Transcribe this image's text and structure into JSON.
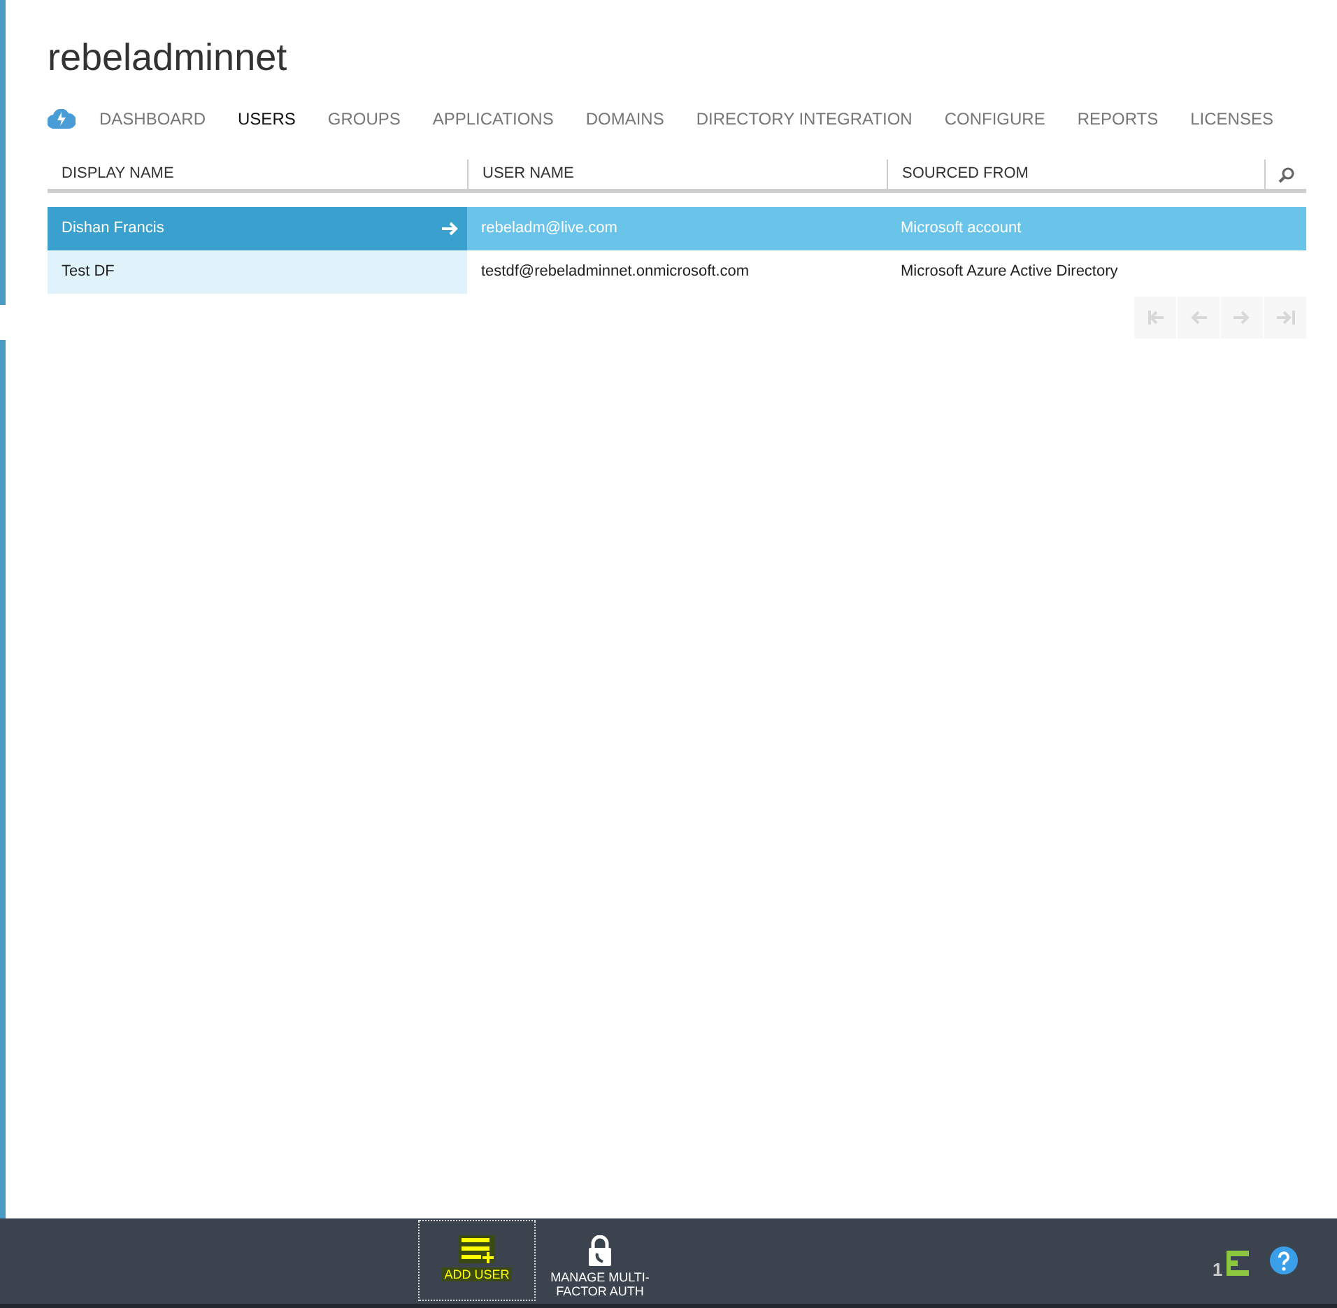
{
  "title": "rebeladminnet",
  "tabs": [
    {
      "label": "DASHBOARD",
      "selected": false
    },
    {
      "label": "USERS",
      "selected": true
    },
    {
      "label": "GROUPS",
      "selected": false
    },
    {
      "label": "APPLICATIONS",
      "selected": false
    },
    {
      "label": "DOMAINS",
      "selected": false
    },
    {
      "label": "DIRECTORY INTEGRATION",
      "selected": false
    },
    {
      "label": "CONFIGURE",
      "selected": false
    },
    {
      "label": "REPORTS",
      "selected": false
    },
    {
      "label": "LICENSES",
      "selected": false
    }
  ],
  "table": {
    "columns": [
      "DISPLAY NAME",
      "USER NAME",
      "SOURCED FROM"
    ],
    "rows": [
      {
        "cells": [
          "Dishan Francis",
          "rebeladm@live.com",
          "Microsoft account"
        ],
        "selected": true
      },
      {
        "cells": [
          "Test DF",
          "testdf@rebeladminnet.onmicrosoft.com",
          "Microsoft Azure Active Directory"
        ],
        "selected": false
      }
    ]
  },
  "pager": {
    "disabled": true
  },
  "command_bar": {
    "buttons": [
      {
        "kind": "add",
        "label": "ADD USER",
        "focused": true
      },
      {
        "kind": "lock",
        "label": "MANAGE MULTI-\nFACTOR AUTH",
        "focused": false
      }
    ],
    "notification_count": "1"
  }
}
